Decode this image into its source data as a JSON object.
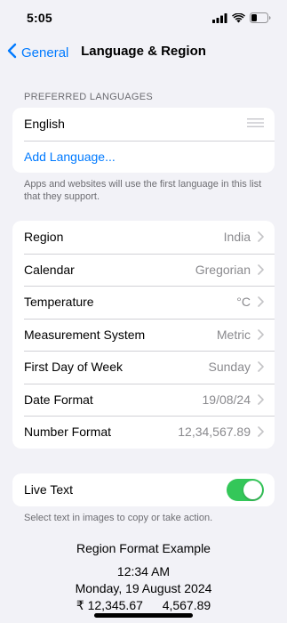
{
  "status_bar": {
    "time": "5:05",
    "icons": [
      "signal-icon",
      "wifi-icon",
      "battery-icon"
    ]
  },
  "nav": {
    "back_label": "General",
    "title": "Language & Region"
  },
  "preferred_languages": {
    "header": "PREFERRED LANGUAGES",
    "languages": [
      "English"
    ],
    "add_label": "Add Language...",
    "footer": "Apps and websites will use the first language in this list that they support."
  },
  "settings": {
    "rows": [
      {
        "label": "Region",
        "value": "India"
      },
      {
        "label": "Calendar",
        "value": "Gregorian"
      },
      {
        "label": "Temperature",
        "value": "°C"
      },
      {
        "label": "Measurement System",
        "value": "Metric"
      },
      {
        "label": "First Day of Week",
        "value": "Sunday"
      },
      {
        "label": "Date Format",
        "value": "19/08/24"
      },
      {
        "label": "Number Format",
        "value": "12,34,567.89"
      }
    ]
  },
  "live_text": {
    "label": "Live Text",
    "enabled": true,
    "footer": "Select text in images to copy or take action."
  },
  "region_example": {
    "title": "Region Format Example",
    "time": "12:34 AM",
    "date": "Monday, 19 August 2024",
    "currency": "₹ 12,345.67",
    "number": "4,567.89"
  },
  "colors": {
    "accent": "#007aff",
    "toggle_on": "#34c759",
    "background": "#f2f2f7",
    "secondary_text": "#8a8a8e"
  }
}
